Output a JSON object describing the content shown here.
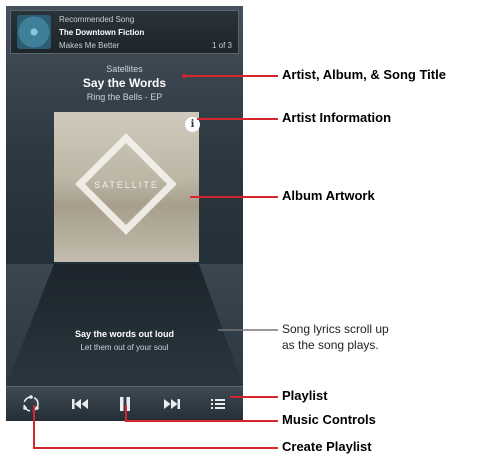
{
  "notification": {
    "label": "Recommended Song",
    "title": "The Downtown Fiction",
    "subtitle": "Makes Me Better",
    "counter": "1 of 3"
  },
  "now_playing": {
    "artist": "Satellites",
    "song": "Say the Words",
    "album": "Ring the Bells - EP"
  },
  "artwork": {
    "text": "SATELLITE",
    "info_label": "i"
  },
  "lyrics": {
    "current": "Say the words out loud",
    "next": "Let them out of your soul"
  },
  "controls": {
    "create_playlist": "create-playlist-icon",
    "previous": "previous-icon",
    "pause": "pause-icon",
    "next": "next-icon",
    "playlist": "playlist-icon"
  },
  "annotations": {
    "titles": "Artist, Album, & Song Title",
    "artist_info": "Artist Information",
    "artwork": "Album Artwork",
    "lyrics_line1": "Song lyrics scroll up",
    "lyrics_line2": "as the song plays.",
    "playlist": "Playlist",
    "music_controls": "Music Controls",
    "create_playlist": "Create Playlist"
  },
  "colors": {
    "callout_line": "#d6262d",
    "lyrics_line": "#777777"
  }
}
